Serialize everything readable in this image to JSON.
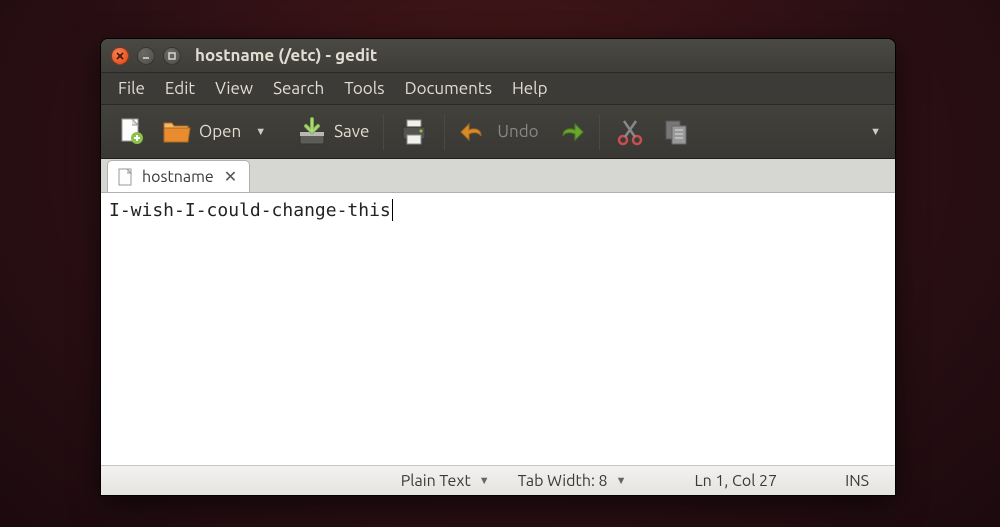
{
  "window": {
    "title": "hostname (/etc) - gedit"
  },
  "menu": {
    "file": "File",
    "edit": "Edit",
    "view": "View",
    "search": "Search",
    "tools": "Tools",
    "documents": "Documents",
    "help": "Help"
  },
  "toolbar": {
    "open": "Open",
    "save": "Save",
    "undo": "Undo"
  },
  "tab": {
    "label": "hostname"
  },
  "editor": {
    "content": "I-wish-I-could-change-this"
  },
  "status": {
    "syntax": "Plain Text",
    "tabwidth": "Tab Width: 8",
    "position": "Ln 1, Col 27",
    "insmode": "INS"
  }
}
